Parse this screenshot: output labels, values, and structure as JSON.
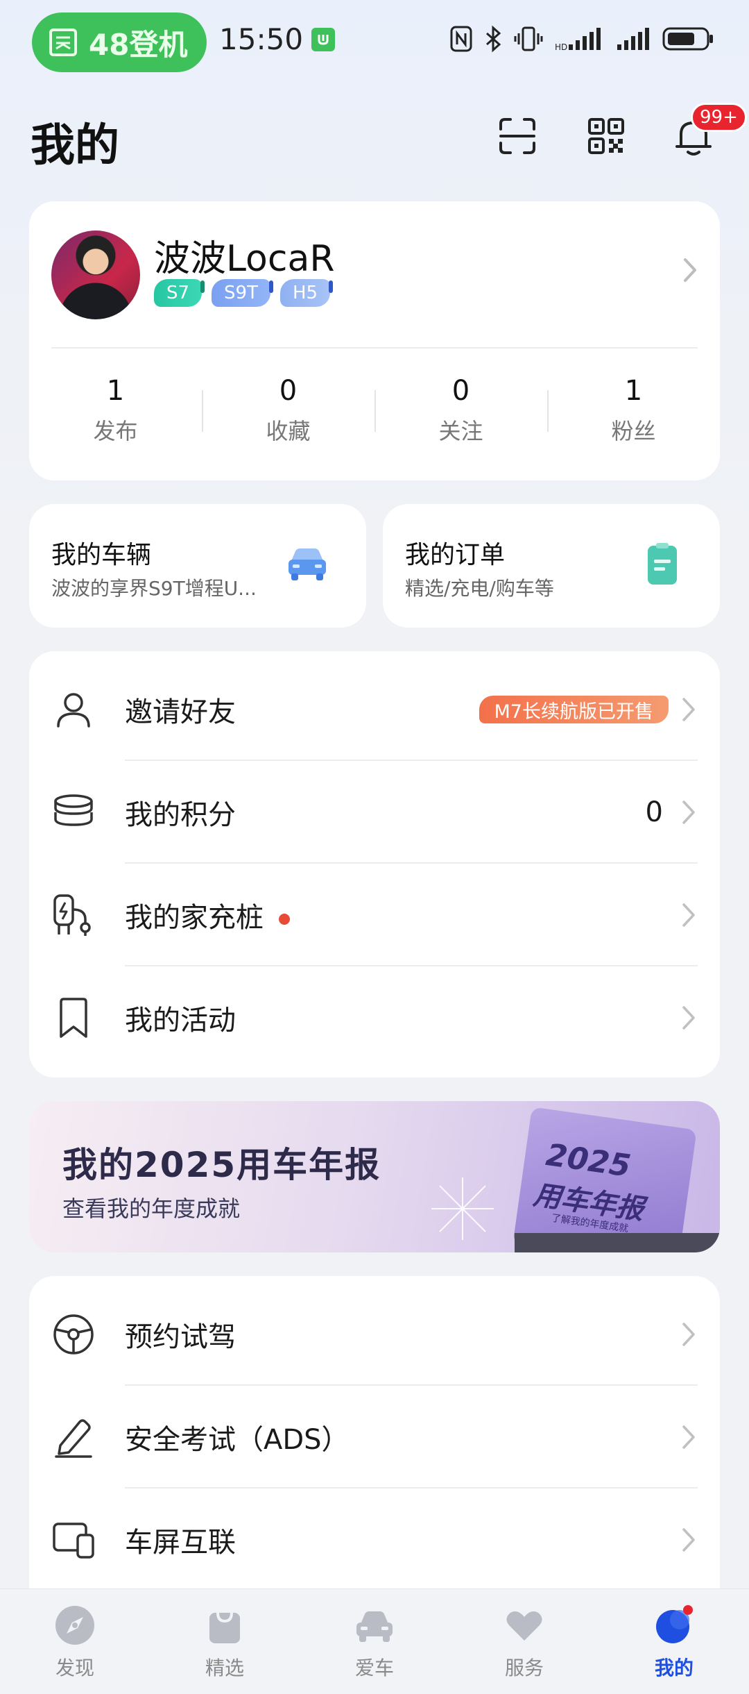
{
  "status_bar": {
    "pill_text": "48登机",
    "time": "15:50"
  },
  "header": {
    "title": "我的",
    "notification_badge": "99+"
  },
  "profile": {
    "username": "波波LocaR",
    "tags": [
      "S7",
      "S9T",
      "H5"
    ],
    "stats": [
      {
        "value": "1",
        "label": "发布"
      },
      {
        "value": "0",
        "label": "收藏"
      },
      {
        "value": "0",
        "label": "关注"
      },
      {
        "value": "1",
        "label": "粉丝"
      }
    ]
  },
  "quick_cards": {
    "vehicles": {
      "title": "我的车辆",
      "subtitle": "波波的享界S9T增程U..."
    },
    "orders": {
      "title": "我的订单",
      "subtitle": "精选/充电/购车等"
    }
  },
  "menu1": {
    "invite": {
      "label": "邀请好友",
      "promo": "M7长续航版已开售"
    },
    "points": {
      "label": "我的积分",
      "value": "0"
    },
    "charger": {
      "label": "我的家充桩"
    },
    "activities": {
      "label": "我的活动"
    }
  },
  "banner": {
    "title": "我的2025用车年报",
    "subtitle": "查看我的年度成就",
    "card_title_year": "2025",
    "card_title_text": "用车年报",
    "card_subtitle": "了解我的年度成就"
  },
  "menu2": {
    "test_drive": {
      "label": "预约试驾"
    },
    "safety_exam": {
      "label": "安全考试（ADS）"
    },
    "screen_link": {
      "label": "车屏互联"
    }
  },
  "bottom_nav": [
    {
      "label": "发现"
    },
    {
      "label": "精选"
    },
    {
      "label": "爱车"
    },
    {
      "label": "服务"
    },
    {
      "label": "我的"
    }
  ],
  "colors": {
    "accent_blue": "#1f4fe0",
    "status_green": "#3ec15a",
    "badge_red": "#e8242f",
    "promo_orange": "#f3714a"
  }
}
